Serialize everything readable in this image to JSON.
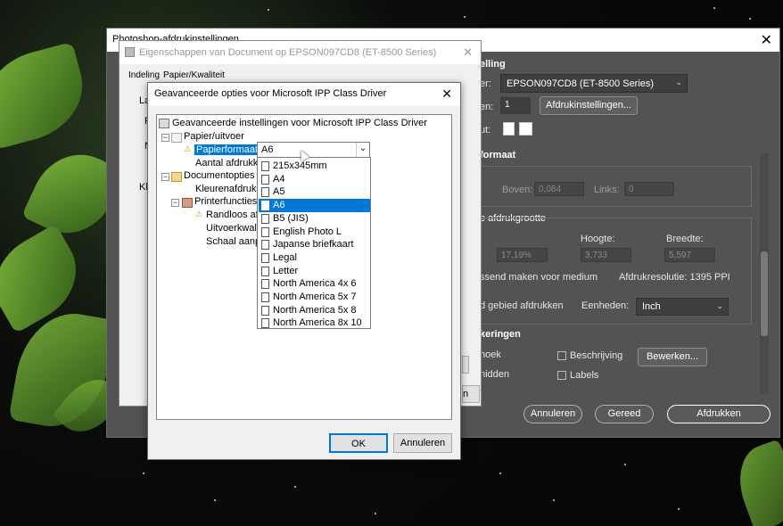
{
  "photoshop": {
    "title": "Photoshop-afdrukinstellingen",
    "close": "✕",
    "printer_section": "elling",
    "printer_label": "er:",
    "printer_value": "EPSON097CD8 (ET-8500 Series)",
    "copies_label": "en:",
    "copies_value": "1",
    "print_settings_button": "Afdrukinstellingen...",
    "layout_label": "ut:",
    "position_section": "formaat",
    "top_label": "Boven:",
    "top_value": "0,084",
    "left_label": "Links:",
    "left_value": "0",
    "scaled_section": "e afdrukgrootte",
    "height_label": "Hoogte:",
    "width_label": "Breedte:",
    "scale_value": "17,19%",
    "height_value": "3,733",
    "width_value": "5,597",
    "fit_media": "ssend maken voor medium",
    "print_resolution": "Afdrukresolutie: 1395 PPI",
    "print_area": "d gebied afdrukken",
    "units_label": "Eenheden:",
    "units_value": "Inch",
    "marks_section": "keringen",
    "corner": "hoek",
    "crop": "nidden",
    "description": "Beschrijving",
    "labels": "Labels",
    "edit_button": "Bewerken...",
    "cancel_button": "Annuleren",
    "done_button": "Gereed",
    "print_button": "Afdrukken"
  },
  "properties": {
    "title": "Eigenschappen van Document op EPSON097CD8 (ET-8500 Series)",
    "close": "✕",
    "tabs": [
      "Indeling",
      "Papier/Kwaliteit"
    ],
    "partial_labels": [
      "La",
      "P",
      "N",
      "Kl"
    ],
    "partial_button": "n"
  },
  "advanced": {
    "title": "Geavanceerde opties voor Microsoft IPP Class Driver",
    "close": "✕",
    "tree": {
      "root": "Geavanceerde instellingen voor Microsoft IPP Class Driver",
      "paper_output": "Papier/uitvoer",
      "paper_size_label": "Papierformaat:",
      "copies": "Aantal afdrukken",
      "document_options": "Documentopties",
      "color_printing": "Kleurenafdrukm",
      "printer_features": "Printerfuncties",
      "borderless": "Randloos afd",
      "output_quality": "Uitvoerkwalit",
      "scale": "Schaal aanpa"
    },
    "combo_value": "A6",
    "ok_button": "OK",
    "cancel_button": "Annuleren"
  },
  "paper_sizes": {
    "selected_index": 3,
    "options": [
      "215x345mm",
      "A4",
      "A5",
      "A6",
      "B5 (JIS)",
      "English Photo L",
      "Japanse briefkaart",
      "Legal",
      "Letter",
      "North America 4x 6",
      "North America 5x 7",
      "North America 5x 8",
      "North America 8x 10"
    ]
  },
  "icons": {
    "warning": "⚠",
    "dropdown": "chevron-down-icon",
    "cursor": "mouse-pointer-icon"
  },
  "colors": {
    "selection": "#0078d7",
    "photoshop_panel": "#535353",
    "warning": "#c79b00"
  }
}
